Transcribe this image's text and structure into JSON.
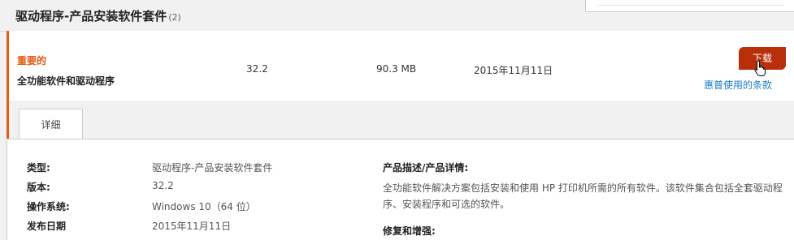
{
  "section": {
    "title": "驱动程序-产品安装软件套件",
    "count": "(2)"
  },
  "row": {
    "importance": "重要的",
    "name": "全功能软件和驱动程序",
    "version": "32.2",
    "size": "90.3 MB",
    "date": "2015年11月11日",
    "download_label": "下载",
    "terms_label": "惠普使用的条款"
  },
  "tabs": [
    {
      "label": "详细"
    }
  ],
  "details": {
    "type_label": "类型:",
    "type_value": "驱动程序-产品安装软件套件",
    "version_label": "版本:",
    "version_value": "32.2",
    "os_label": "操作系统:",
    "os_value": "Windows 10（64 位）",
    "release_label": "发布日期",
    "release_value": "2015年11月11日",
    "description_heading": "产品描述/产品详情:",
    "description_text": "全功能软件解决方案包括安装和使用 HP 打印机所需的所有软件。该软件集合包括全套驱动程序、安装程序和可选的软件。",
    "fixes_heading": "修复和增强:"
  },
  "colors": {
    "accent": "#e55b13",
    "button": "#b7300a",
    "link": "#1a7fc4"
  },
  "icons": {
    "cursor": "hand-pointer-icon"
  }
}
